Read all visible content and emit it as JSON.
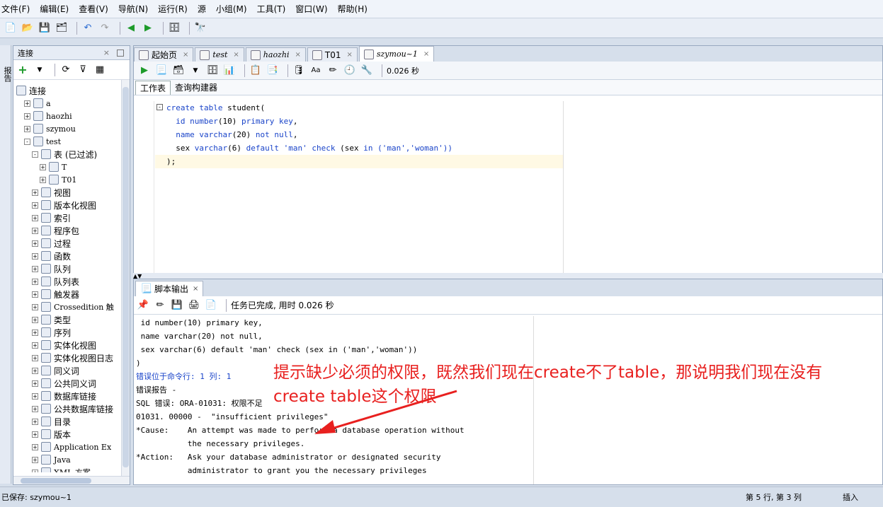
{
  "menu": [
    "文件(F)",
    "编辑(E)",
    "查看(V)",
    "导航(N)",
    "运行(R)",
    "源",
    "小组(M)",
    "工具(T)",
    "窗口(W)",
    "帮助(H)"
  ],
  "left_strip": {
    "label": "报告"
  },
  "connections": {
    "title": "连接",
    "tree": [
      {
        "label": "连接",
        "level": 0,
        "expander": "none"
      },
      {
        "label": "a",
        "level": 1,
        "expander": "+"
      },
      {
        "label": "haozhi",
        "level": 1,
        "expander": "+"
      },
      {
        "label": "szymou",
        "level": 1,
        "expander": "+"
      },
      {
        "label": "test",
        "level": 1,
        "expander": "-"
      },
      {
        "label": "表 (已过滤)",
        "level": 2,
        "expander": "-"
      },
      {
        "label": "T",
        "level": 3,
        "expander": "+"
      },
      {
        "label": "T01",
        "level": 3,
        "expander": "+"
      },
      {
        "label": "视图",
        "level": 2,
        "expander": "+"
      },
      {
        "label": "版本化视图",
        "level": 2,
        "expander": "+"
      },
      {
        "label": "索引",
        "level": 2,
        "expander": "+"
      },
      {
        "label": "程序包",
        "level": 2,
        "expander": "+"
      },
      {
        "label": "过程",
        "level": 2,
        "expander": "+"
      },
      {
        "label": "函数",
        "level": 2,
        "expander": "+"
      },
      {
        "label": "队列",
        "level": 2,
        "expander": "+"
      },
      {
        "label": "队列表",
        "level": 2,
        "expander": "+"
      },
      {
        "label": "触发器",
        "level": 2,
        "expander": "+"
      },
      {
        "label": "Crossedition 触",
        "level": 2,
        "expander": "+"
      },
      {
        "label": "类型",
        "level": 2,
        "expander": "+"
      },
      {
        "label": "序列",
        "level": 2,
        "expander": "+"
      },
      {
        "label": "实体化视图",
        "level": 2,
        "expander": "+"
      },
      {
        "label": "实体化视图日志",
        "level": 2,
        "expander": "+"
      },
      {
        "label": "同义词",
        "level": 2,
        "expander": "+"
      },
      {
        "label": "公共同义词",
        "level": 2,
        "expander": "+"
      },
      {
        "label": "数据库链接",
        "level": 2,
        "expander": "+"
      },
      {
        "label": "公共数据库链接",
        "level": 2,
        "expander": "+"
      },
      {
        "label": "目录",
        "level": 2,
        "expander": "+"
      },
      {
        "label": "版本",
        "level": 2,
        "expander": "+"
      },
      {
        "label": "Application Ex",
        "level": 2,
        "expander": "+"
      },
      {
        "label": "Java",
        "level": 2,
        "expander": "+"
      },
      {
        "label": "XML 方案",
        "level": 2,
        "expander": "+"
      }
    ]
  },
  "editor": {
    "tabs": [
      {
        "label": "起始页",
        "italic": false
      },
      {
        "label": "test",
        "italic": true
      },
      {
        "label": "haozhi",
        "italic": true
      },
      {
        "label": "T01",
        "italic": false
      },
      {
        "label": "szymou~1",
        "italic": true
      }
    ],
    "toolbar_time": "0.026 秒",
    "subtabs": [
      "工作表",
      "查询构建器"
    ],
    "code": {
      "l1_kw1": "create",
      "l1_kw2": "table",
      "l1_rest": " student(",
      "l2_a": "id ",
      "l2_b": "number",
      "l2_c": "(10) ",
      "l2_d": "primary key",
      "l2_e": ",",
      "l3_a": "name ",
      "l3_b": "varchar",
      "l3_c": "(20) ",
      "l3_d": "not null",
      "l3_e": ",",
      "l4_a": "sex ",
      "l4_b": "varchar",
      "l4_c": "(6) ",
      "l4_d": "default",
      "l4_e": " 'man' ",
      "l4_f": "check",
      "l4_g": " (sex ",
      "l4_h": "in",
      "l4_i": " ('man','woman'))",
      "l5": ");"
    }
  },
  "output": {
    "tab": "脚本输出",
    "status": "任务已完成, 用时 0.026 秒",
    "lines": [
      " id number(10) primary key,",
      " name varchar(20) not null,",
      " sex varchar(6) default 'man' check (sex in ('man','woman'))",
      ")",
      "错误位于命令行: 1 列: 1",
      "错误报告 -",
      "SQL 错误: ORA-01031: 权限不足",
      "01031. 00000 -  \"insufficient privileges\"",
      "*Cause:    An attempt was made to perform a database operation without",
      "           the necessary privileges.",
      "*Action:   Ask your database administrator or designated security",
      "           administrator to grant you the necessary privileges"
    ]
  },
  "annotation": {
    "line1": "提示缺少必须的权限，既然我们现在create不了table，那说明我们现在没有",
    "line2": "create table这个权限",
    "color": "#e8201f"
  },
  "status": {
    "saved": "已保存: szymou~1",
    "position": "第 5 行, 第 3 列",
    "mode": "插入"
  }
}
